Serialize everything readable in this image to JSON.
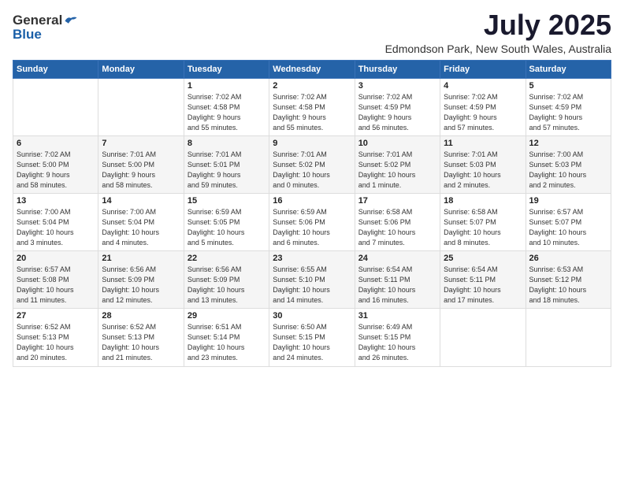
{
  "logo": {
    "general": "General",
    "blue": "Blue"
  },
  "title": "July 2025",
  "location": "Edmondson Park, New South Wales, Australia",
  "days_header": [
    "Sunday",
    "Monday",
    "Tuesday",
    "Wednesday",
    "Thursday",
    "Friday",
    "Saturday"
  ],
  "weeks": [
    [
      {
        "day": "",
        "info": ""
      },
      {
        "day": "",
        "info": ""
      },
      {
        "day": "1",
        "info": "Sunrise: 7:02 AM\nSunset: 4:58 PM\nDaylight: 9 hours\nand 55 minutes."
      },
      {
        "day": "2",
        "info": "Sunrise: 7:02 AM\nSunset: 4:58 PM\nDaylight: 9 hours\nand 55 minutes."
      },
      {
        "day": "3",
        "info": "Sunrise: 7:02 AM\nSunset: 4:59 PM\nDaylight: 9 hours\nand 56 minutes."
      },
      {
        "day": "4",
        "info": "Sunrise: 7:02 AM\nSunset: 4:59 PM\nDaylight: 9 hours\nand 57 minutes."
      },
      {
        "day": "5",
        "info": "Sunrise: 7:02 AM\nSunset: 4:59 PM\nDaylight: 9 hours\nand 57 minutes."
      }
    ],
    [
      {
        "day": "6",
        "info": "Sunrise: 7:02 AM\nSunset: 5:00 PM\nDaylight: 9 hours\nand 58 minutes."
      },
      {
        "day": "7",
        "info": "Sunrise: 7:01 AM\nSunset: 5:00 PM\nDaylight: 9 hours\nand 58 minutes."
      },
      {
        "day": "8",
        "info": "Sunrise: 7:01 AM\nSunset: 5:01 PM\nDaylight: 9 hours\nand 59 minutes."
      },
      {
        "day": "9",
        "info": "Sunrise: 7:01 AM\nSunset: 5:02 PM\nDaylight: 10 hours\nand 0 minutes."
      },
      {
        "day": "10",
        "info": "Sunrise: 7:01 AM\nSunset: 5:02 PM\nDaylight: 10 hours\nand 1 minute."
      },
      {
        "day": "11",
        "info": "Sunrise: 7:01 AM\nSunset: 5:03 PM\nDaylight: 10 hours\nand 2 minutes."
      },
      {
        "day": "12",
        "info": "Sunrise: 7:00 AM\nSunset: 5:03 PM\nDaylight: 10 hours\nand 2 minutes."
      }
    ],
    [
      {
        "day": "13",
        "info": "Sunrise: 7:00 AM\nSunset: 5:04 PM\nDaylight: 10 hours\nand 3 minutes."
      },
      {
        "day": "14",
        "info": "Sunrise: 7:00 AM\nSunset: 5:04 PM\nDaylight: 10 hours\nand 4 minutes."
      },
      {
        "day": "15",
        "info": "Sunrise: 6:59 AM\nSunset: 5:05 PM\nDaylight: 10 hours\nand 5 minutes."
      },
      {
        "day": "16",
        "info": "Sunrise: 6:59 AM\nSunset: 5:06 PM\nDaylight: 10 hours\nand 6 minutes."
      },
      {
        "day": "17",
        "info": "Sunrise: 6:58 AM\nSunset: 5:06 PM\nDaylight: 10 hours\nand 7 minutes."
      },
      {
        "day": "18",
        "info": "Sunrise: 6:58 AM\nSunset: 5:07 PM\nDaylight: 10 hours\nand 8 minutes."
      },
      {
        "day": "19",
        "info": "Sunrise: 6:57 AM\nSunset: 5:07 PM\nDaylight: 10 hours\nand 10 minutes."
      }
    ],
    [
      {
        "day": "20",
        "info": "Sunrise: 6:57 AM\nSunset: 5:08 PM\nDaylight: 10 hours\nand 11 minutes."
      },
      {
        "day": "21",
        "info": "Sunrise: 6:56 AM\nSunset: 5:09 PM\nDaylight: 10 hours\nand 12 minutes."
      },
      {
        "day": "22",
        "info": "Sunrise: 6:56 AM\nSunset: 5:09 PM\nDaylight: 10 hours\nand 13 minutes."
      },
      {
        "day": "23",
        "info": "Sunrise: 6:55 AM\nSunset: 5:10 PM\nDaylight: 10 hours\nand 14 minutes."
      },
      {
        "day": "24",
        "info": "Sunrise: 6:54 AM\nSunset: 5:11 PM\nDaylight: 10 hours\nand 16 minutes."
      },
      {
        "day": "25",
        "info": "Sunrise: 6:54 AM\nSunset: 5:11 PM\nDaylight: 10 hours\nand 17 minutes."
      },
      {
        "day": "26",
        "info": "Sunrise: 6:53 AM\nSunset: 5:12 PM\nDaylight: 10 hours\nand 18 minutes."
      }
    ],
    [
      {
        "day": "27",
        "info": "Sunrise: 6:52 AM\nSunset: 5:13 PM\nDaylight: 10 hours\nand 20 minutes."
      },
      {
        "day": "28",
        "info": "Sunrise: 6:52 AM\nSunset: 5:13 PM\nDaylight: 10 hours\nand 21 minutes."
      },
      {
        "day": "29",
        "info": "Sunrise: 6:51 AM\nSunset: 5:14 PM\nDaylight: 10 hours\nand 23 minutes."
      },
      {
        "day": "30",
        "info": "Sunrise: 6:50 AM\nSunset: 5:15 PM\nDaylight: 10 hours\nand 24 minutes."
      },
      {
        "day": "31",
        "info": "Sunrise: 6:49 AM\nSunset: 5:15 PM\nDaylight: 10 hours\nand 26 minutes."
      },
      {
        "day": "",
        "info": ""
      },
      {
        "day": "",
        "info": ""
      }
    ]
  ]
}
